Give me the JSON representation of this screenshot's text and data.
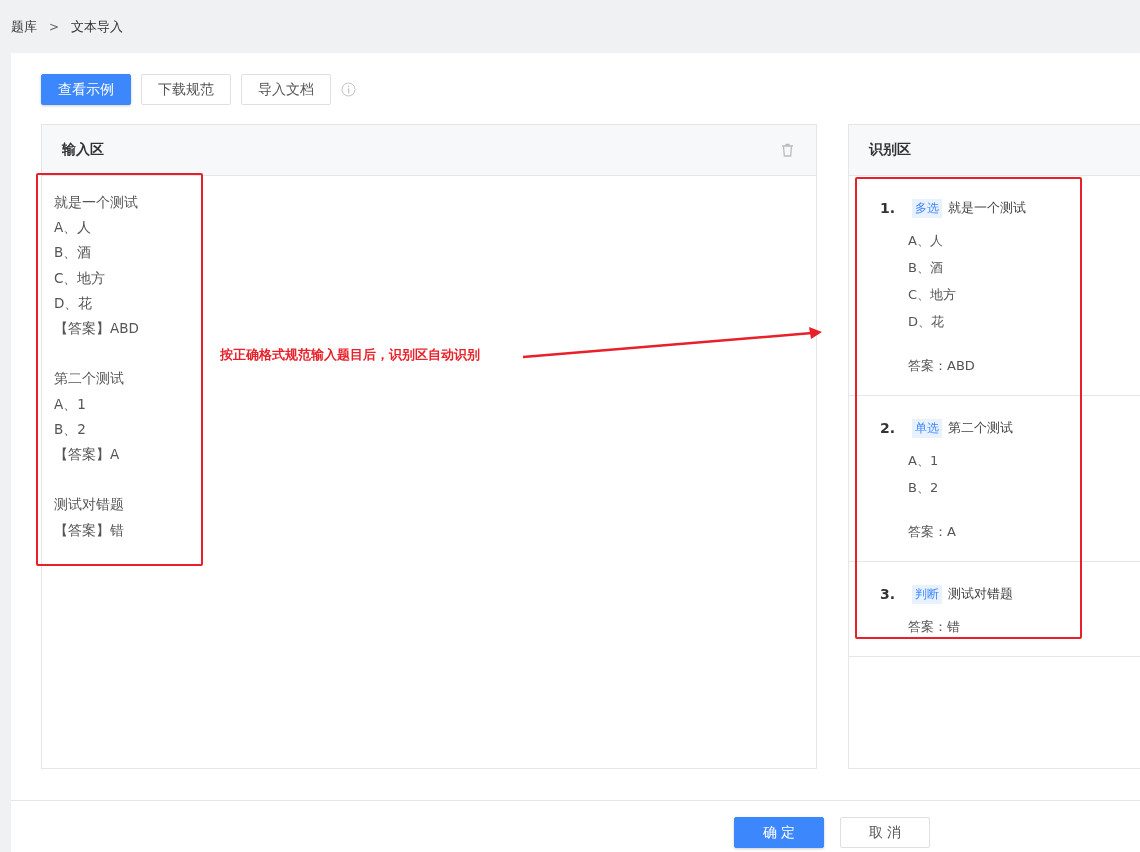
{
  "breadcrumb": {
    "items": [
      "题库",
      "文本导入"
    ],
    "separator": ">"
  },
  "toolbar": {
    "buttons": [
      {
        "label": "查看示例",
        "kind": "primary"
      },
      {
        "label": "下载规范",
        "kind": "default"
      },
      {
        "label": "导入文档",
        "kind": "default"
      }
    ]
  },
  "input_panel": {
    "title": "输入区",
    "blocks": [
      [
        "就是一个测试",
        "A、人",
        "B、酒",
        "C、地方",
        "D、花",
        "【答案】ABD"
      ],
      [
        "第二个测试",
        "A、1",
        "B、2",
        "【答案】A"
      ],
      [
        "测试对错题",
        "【答案】错"
      ]
    ]
  },
  "recognition_panel": {
    "title": "识别区",
    "questions": [
      {
        "number": "1.",
        "type": "多选",
        "text": "就是一个测试",
        "options": [
          "A、人",
          "B、酒",
          "C、地方",
          "D、花"
        ],
        "answer": "答案：ABD"
      },
      {
        "number": "2.",
        "type": "单选",
        "text": "第二个测试",
        "options": [
          "A、1",
          "B、2"
        ],
        "answer": "答案：A"
      },
      {
        "number": "3.",
        "type": "判断",
        "text": "测试对错题",
        "answer": "答案：错"
      }
    ]
  },
  "annotation": {
    "text": "按正确格式规范输入题目后，识别区自动识别"
  },
  "footer": {
    "buttons": [
      {
        "label": "确 定",
        "kind": "primary"
      },
      {
        "label": "取 消",
        "kind": "default"
      }
    ]
  }
}
